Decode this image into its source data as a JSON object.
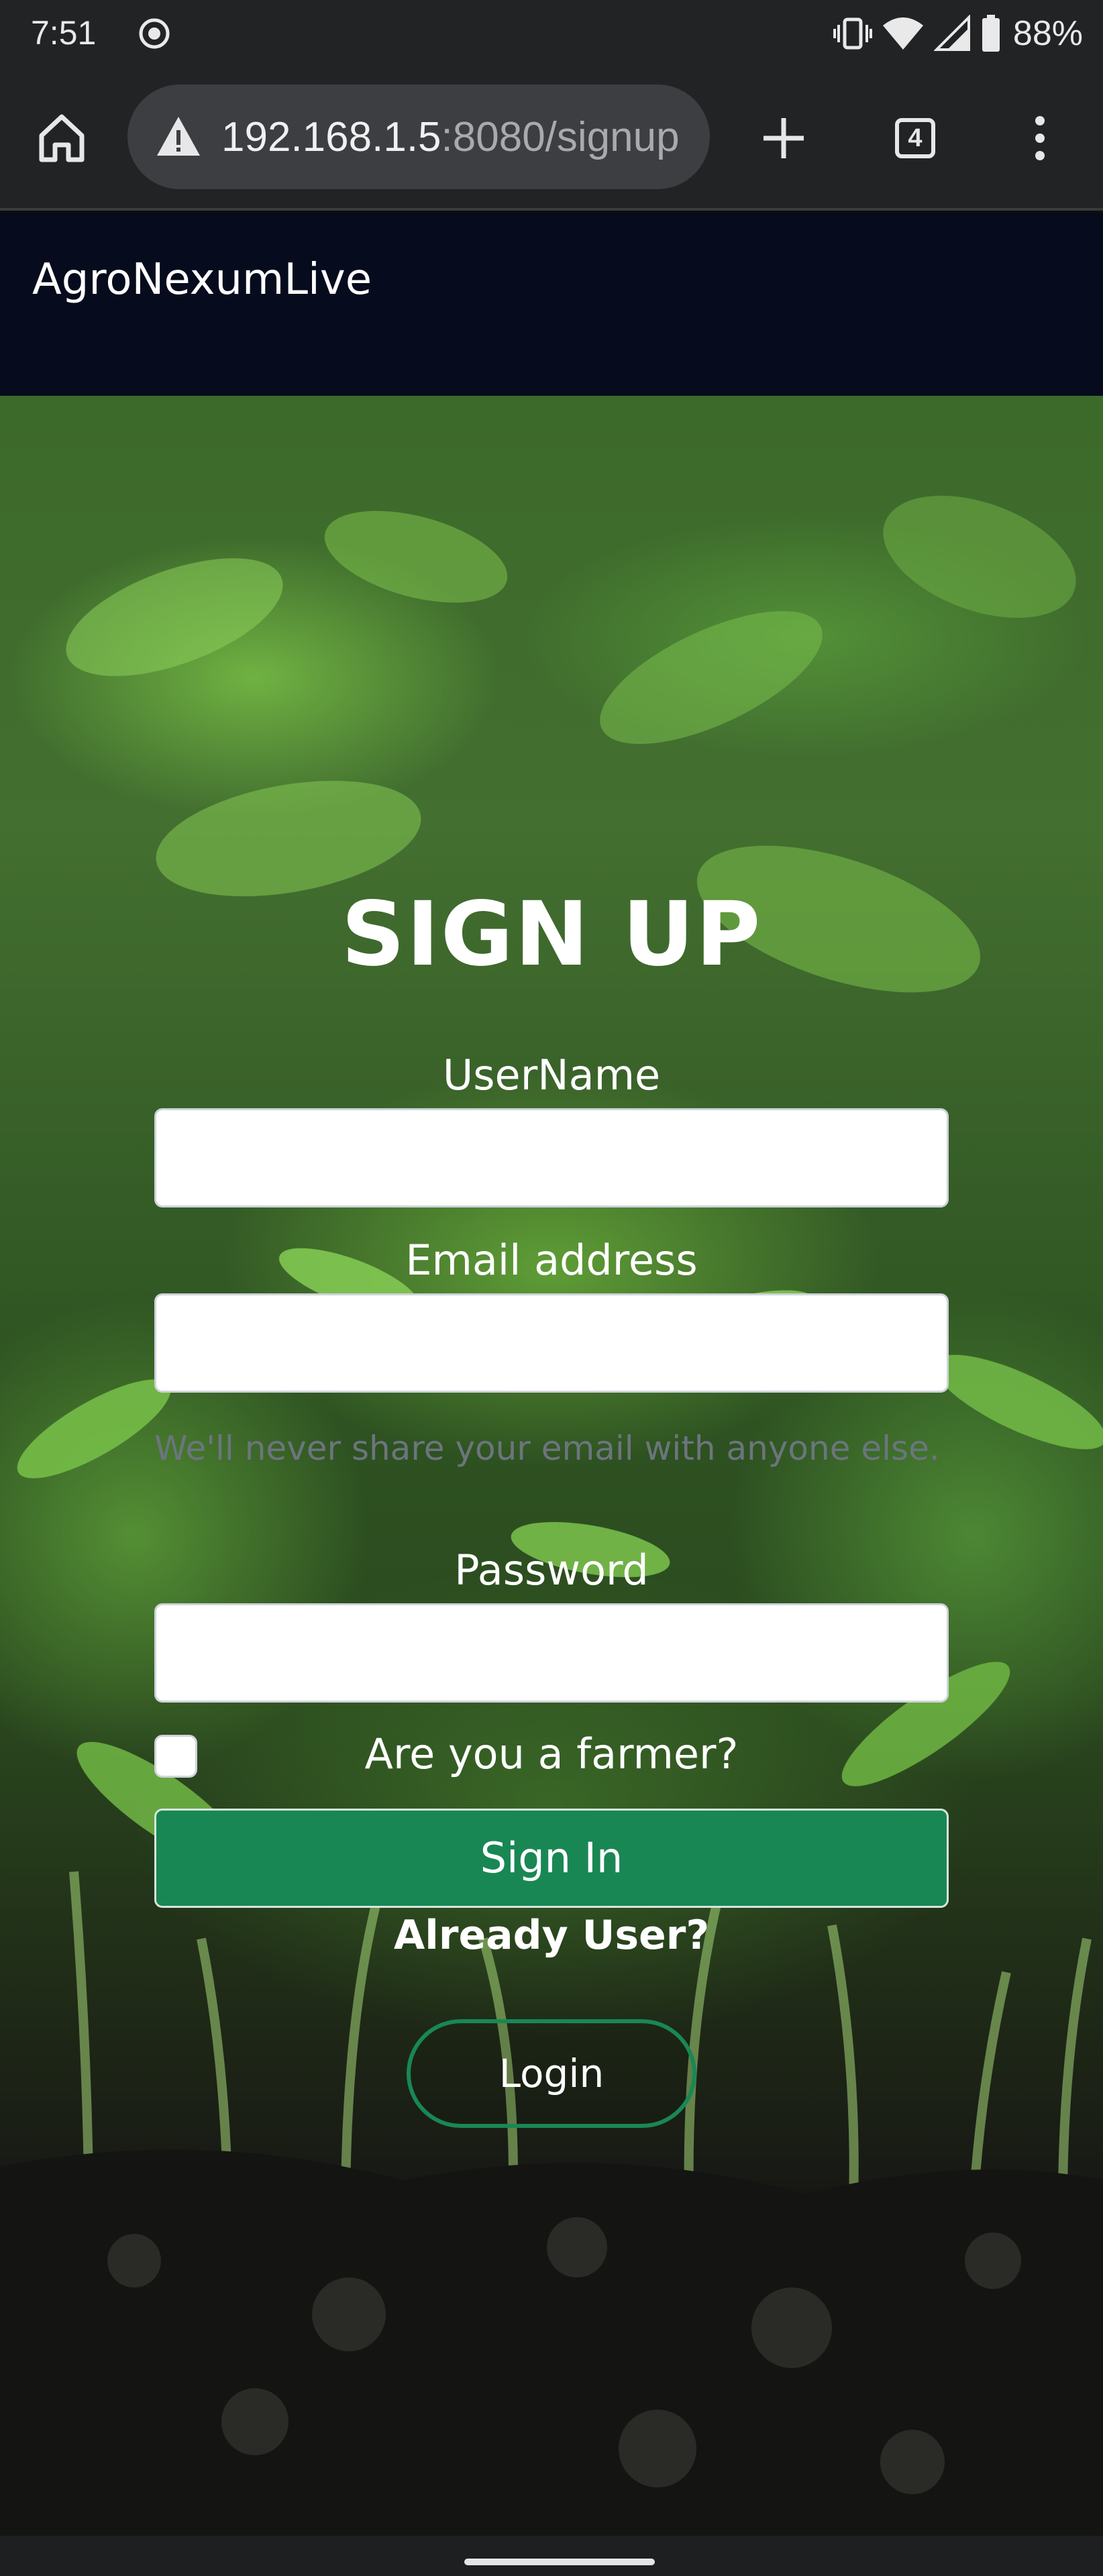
{
  "status_bar": {
    "time": "7:51",
    "battery": "88%"
  },
  "browser": {
    "url_host": "192.168.1.5",
    "url_path": ":8080/signup",
    "tab_count": "4"
  },
  "site": {
    "brand": "AgroNexumLive"
  },
  "form": {
    "title": "SIGN UP",
    "username_label": "UserName",
    "username_value": "",
    "email_label": "Email address",
    "email_value": "",
    "email_help": "We'll never share your email with anyone else.",
    "password_label": "Password",
    "password_value": "",
    "farmer_label": "Are you a farmer?",
    "farmer_checked": false,
    "submit_label": "Sign In",
    "already_user": "Already User?",
    "login_label": "Login"
  },
  "colors": {
    "navbar_bg": "#060b1d",
    "primary_green": "#198754",
    "browser_chrome": "#222325"
  },
  "icons": [
    "screen-record-icon",
    "vibrate-icon",
    "wifi-icon",
    "signal-icon",
    "battery-icon",
    "home-icon",
    "warning-icon",
    "plus-icon",
    "tab-switcher-icon",
    "more-vert-icon"
  ]
}
